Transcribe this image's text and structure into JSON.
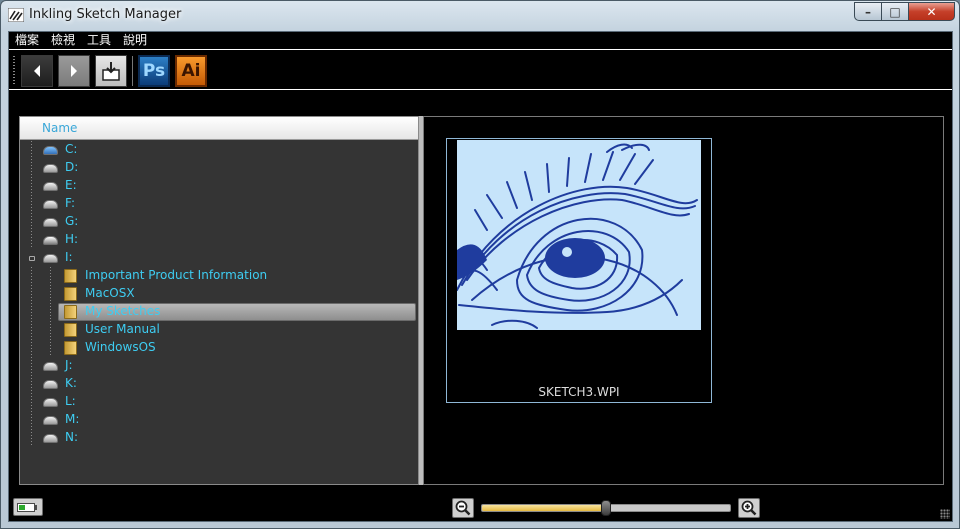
{
  "window": {
    "title": "Inkling Sketch Manager",
    "caption_min": "–",
    "caption_max": "□",
    "caption_close": "✕"
  },
  "menu": [
    {
      "label": "檔案"
    },
    {
      "label": "檢視"
    },
    {
      "label": "工具"
    },
    {
      "label": "說明"
    }
  ],
  "toolbar": {
    "back_icon": "arrow-left-icon",
    "forward_icon": "arrow-right-icon",
    "export_icon": "export-tray-icon",
    "photoshop_label": "Ps",
    "illustrator_label": "Ai"
  },
  "tree": {
    "header": "Name",
    "nodes": [
      {
        "label": "C:",
        "icon": "system-drive-icon",
        "level": 0
      },
      {
        "label": "D:",
        "icon": "drive-icon",
        "level": 0
      },
      {
        "label": "E:",
        "icon": "drive-icon",
        "level": 0
      },
      {
        "label": "F:",
        "icon": "drive-icon",
        "level": 0
      },
      {
        "label": "G:",
        "icon": "drive-icon",
        "level": 0
      },
      {
        "label": "H:",
        "icon": "network-drive-icon",
        "level": 0
      },
      {
        "label": "I:",
        "icon": "removable-drive-icon",
        "level": 0,
        "expanded": true
      },
      {
        "label": "Important Product Information",
        "icon": "folder-icon",
        "level": 1
      },
      {
        "label": "MacOSX",
        "icon": "folder-icon",
        "level": 1
      },
      {
        "label": "My Sketches",
        "icon": "folder-icon",
        "level": 1,
        "selected": true
      },
      {
        "label": "User Manual",
        "icon": "folder-icon",
        "level": 1
      },
      {
        "label": "WindowsOS",
        "icon": "folder-icon",
        "level": 1
      },
      {
        "label": "J:",
        "icon": "removable-drive-icon",
        "level": 0
      },
      {
        "label": "K:",
        "icon": "removable-drive-icon",
        "level": 0
      },
      {
        "label": "L:",
        "icon": "removable-drive-icon",
        "level": 0
      },
      {
        "label": "M:",
        "icon": "removable-drive-icon",
        "level": 0
      },
      {
        "label": "N:",
        "icon": "removable-drive-icon",
        "level": 0
      }
    ]
  },
  "preview": {
    "caption": "SKETCH3.WPI",
    "thumbnail_icon": "eye-sketch-thumbnail"
  },
  "status": {
    "battery_icon": "battery-icon",
    "zoom_out_icon": "zoom-out-icon",
    "zoom_in_icon": "zoom-in-icon",
    "zoom_level": 0.5
  },
  "colors": {
    "tree_text": "#3ecdf2",
    "sketch_ink": "#1f3c9e",
    "sketch_bg": "#c6e4fa"
  }
}
